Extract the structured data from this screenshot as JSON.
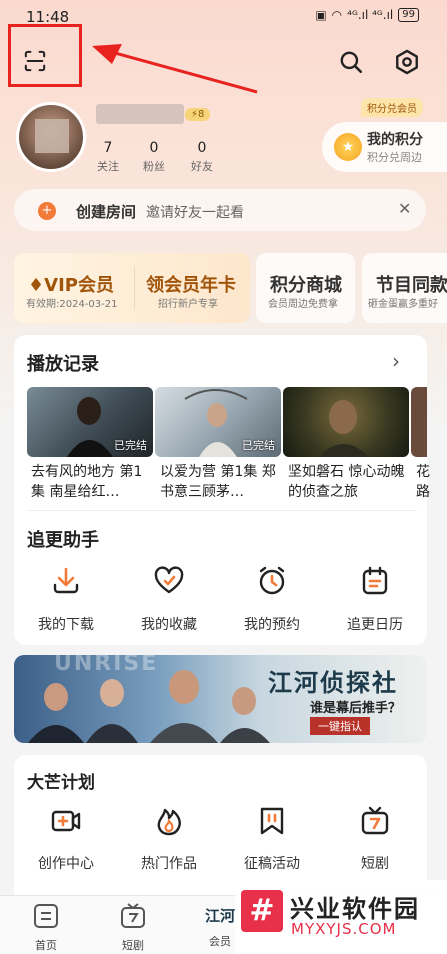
{
  "status_bar": {
    "time": "11:48",
    "battery": "99",
    "signal_text": "⁴ᴳ.ıl ⁴ᴳ.ıl"
  },
  "header": {
    "scan_icon": "scan-icon",
    "search_icon": "search-icon",
    "settings_icon": "settings-icon"
  },
  "profile": {
    "level": "8",
    "stats": [
      {
        "value": "7",
        "label": "关注"
      },
      {
        "value": "0",
        "label": "粉丝"
      },
      {
        "value": "0",
        "label": "好友"
      }
    ],
    "points_tag": "积分兑会员",
    "points_title": "我的积分",
    "points_sub": "积分兑周边"
  },
  "create_room": {
    "title": "创建房间",
    "subtitle": "邀请好友一起看",
    "close": "✕"
  },
  "cards": {
    "vip_title": "VIP会员",
    "vip_sub": "有效期:2024-03-21",
    "annual_title": "领会员年卡",
    "annual_sub": "招行新户专享",
    "mall_title": "积分商城",
    "mall_sub": "会员周边免费拿",
    "show_title": "节目同款",
    "show_sub": "砸金蛋赢多重好"
  },
  "history": {
    "title": "播放记录",
    "items": [
      {
        "title": "去有风的地方 第1集 南星给红…",
        "tag": "已完结"
      },
      {
        "title": "以爱为营 第1集 郑书意三顾茅…",
        "tag": "已完结"
      },
      {
        "title": "坚如磐石 惊心动魄的侦查之旅",
        "tag": ""
      },
      {
        "title": "花路",
        "tag": ""
      }
    ]
  },
  "helper": {
    "title": "追更助手",
    "items": [
      {
        "label": "我的下载",
        "icon": "download-icon"
      },
      {
        "label": "我的收藏",
        "icon": "heart-icon"
      },
      {
        "label": "我的预约",
        "icon": "alarm-icon"
      },
      {
        "label": "追更日历",
        "icon": "calendar-icon"
      }
    ]
  },
  "banner": {
    "title": "江河侦探社",
    "subtitle": "谁是幕后推手？",
    "cta": "一键指认",
    "bg_text": "UNRISE"
  },
  "mango_plan": {
    "title": "大芒计划",
    "items": [
      {
        "label": "创作中心",
        "icon": "video-add-icon"
      },
      {
        "label": "热门作品",
        "icon": "flame-icon"
      },
      {
        "label": "征稿活动",
        "icon": "bookmark-icon"
      },
      {
        "label": "短剧",
        "icon": "tv-icon"
      }
    ]
  },
  "tabs": [
    {
      "label": "首页",
      "icon": "home-icon"
    },
    {
      "label": "短剧",
      "icon": "tv-icon"
    },
    {
      "label": "会员",
      "icon": "member-icon",
      "brand": "江河"
    }
  ],
  "watermark": {
    "title": "兴业软件园",
    "url": "MYXYJS.COM"
  },
  "colors": {
    "accent": "#f37b3a",
    "highlight_box": "#e8231f",
    "vip_gold": "#a0550b"
  }
}
